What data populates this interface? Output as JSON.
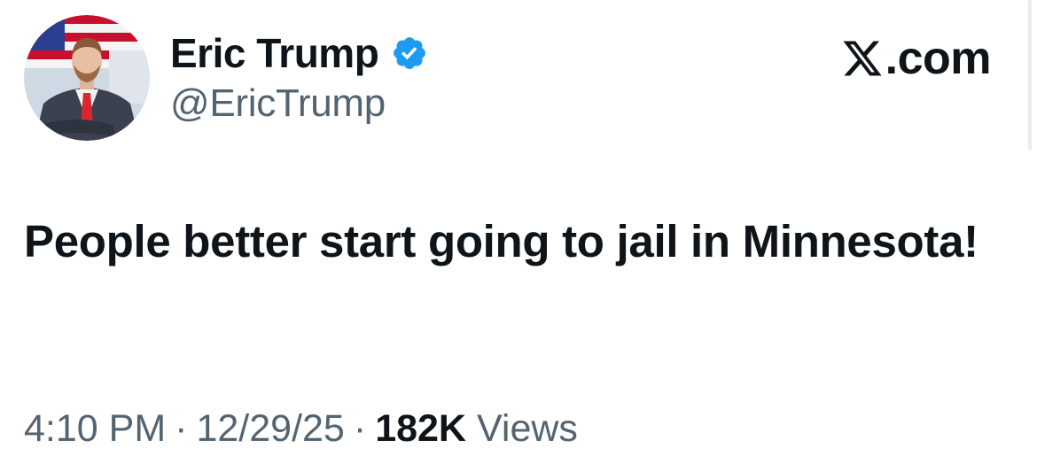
{
  "author": {
    "display_name": "Eric Trump",
    "handle": "@EricTrump",
    "avatar_icon": "profile-photo-icon",
    "verified": true,
    "verified_icon": "verified-badge-icon",
    "verified_color": "#1d9bf0"
  },
  "brand": {
    "logo_icon": "x-logo-icon",
    "suffix": ".com"
  },
  "tweet": {
    "text": "People better start going to jail in Minnesota!"
  },
  "meta": {
    "time": "4:10 PM",
    "date": "12/29/25",
    "separator": "·",
    "views_count": "182K",
    "views_label": "Views"
  },
  "colors": {
    "text_primary": "#0f1419",
    "text_secondary": "#536471",
    "background": "#ffffff"
  }
}
